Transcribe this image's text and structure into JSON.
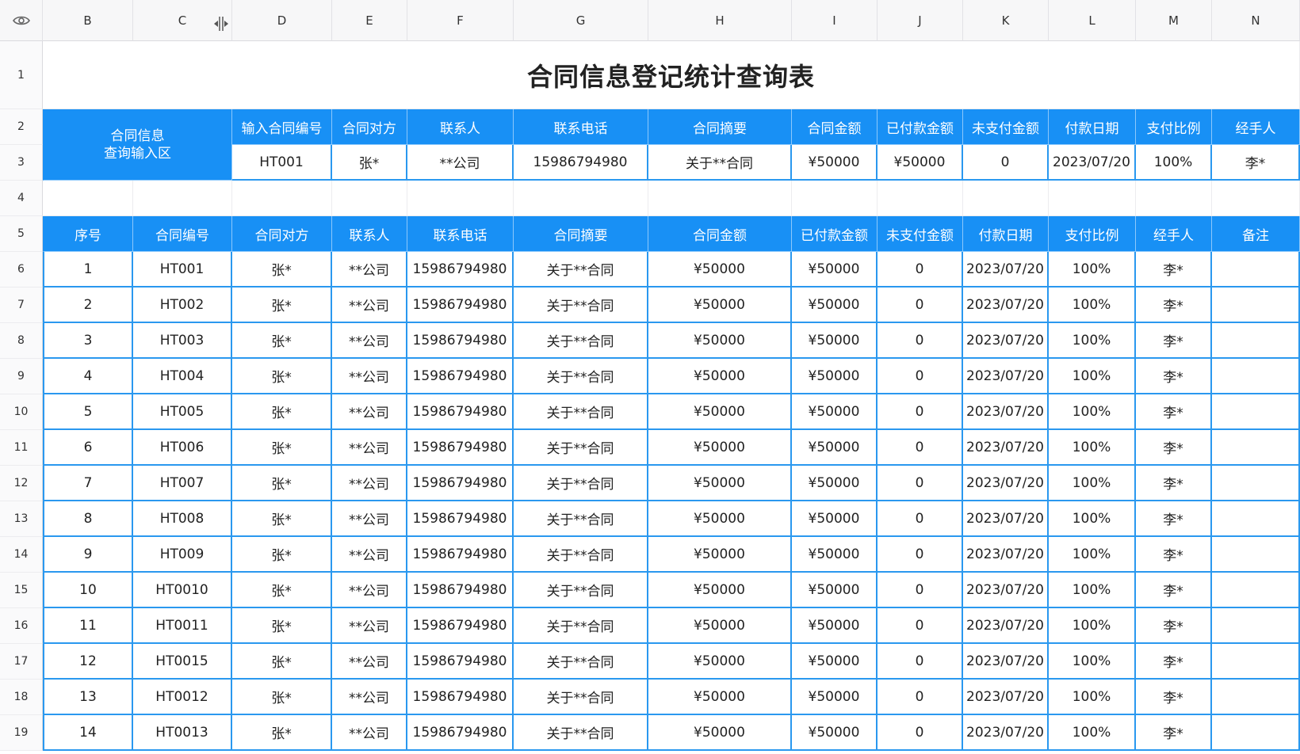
{
  "toolbar": {
    "visibility_icon": "eye-icon"
  },
  "columns": [
    "B",
    "C",
    "D",
    "E",
    "F",
    "G",
    "H",
    "I",
    "J",
    "K",
    "L",
    "M",
    "N"
  ],
  "rows": [
    "1",
    "2",
    "3",
    "4",
    "5",
    "6",
    "7",
    "8",
    "9",
    "10",
    "11",
    "12",
    "13",
    "14",
    "15",
    "16",
    "17",
    "18",
    "19"
  ],
  "title": "合同信息登记统计查询表",
  "query": {
    "label_line1": "合同信息",
    "label_line2": "查询输入区",
    "headers": [
      "输入合同编号",
      "合同对方",
      "联系人",
      "联系电话",
      "合同摘要",
      "合同金额",
      "已付款金额",
      "未支付金额",
      "付款日期",
      "支付比例",
      "经手人"
    ],
    "values": [
      "HT001",
      "张*",
      "**公司",
      "15986794980",
      "关于**合同",
      "¥50000",
      "¥50000",
      "0",
      "2023/07/20",
      "100%",
      "李*"
    ]
  },
  "table": {
    "headers": [
      "序号",
      "合同编号",
      "合同对方",
      "联系人",
      "联系电话",
      "合同摘要",
      "合同金额",
      "已付款金额",
      "未支付金额",
      "付款日期",
      "支付比例",
      "经手人",
      "备注"
    ],
    "rows": [
      [
        "1",
        "HT001",
        "张*",
        "**公司",
        "15986794980",
        "关于**合同",
        "¥50000",
        "¥50000",
        "0",
        "2023/07/20",
        "100%",
        "李*",
        ""
      ],
      [
        "2",
        "HT002",
        "张*",
        "**公司",
        "15986794980",
        "关于**合同",
        "¥50000",
        "¥50000",
        "0",
        "2023/07/20",
        "100%",
        "李*",
        ""
      ],
      [
        "3",
        "HT003",
        "张*",
        "**公司",
        "15986794980",
        "关于**合同",
        "¥50000",
        "¥50000",
        "0",
        "2023/07/20",
        "100%",
        "李*",
        ""
      ],
      [
        "4",
        "HT004",
        "张*",
        "**公司",
        "15986794980",
        "关于**合同",
        "¥50000",
        "¥50000",
        "0",
        "2023/07/20",
        "100%",
        "李*",
        ""
      ],
      [
        "5",
        "HT005",
        "张*",
        "**公司",
        "15986794980",
        "关于**合同",
        "¥50000",
        "¥50000",
        "0",
        "2023/07/20",
        "100%",
        "李*",
        ""
      ],
      [
        "6",
        "HT006",
        "张*",
        "**公司",
        "15986794980",
        "关于**合同",
        "¥50000",
        "¥50000",
        "0",
        "2023/07/20",
        "100%",
        "李*",
        ""
      ],
      [
        "7",
        "HT007",
        "张*",
        "**公司",
        "15986794980",
        "关于**合同",
        "¥50000",
        "¥50000",
        "0",
        "2023/07/20",
        "100%",
        "李*",
        ""
      ],
      [
        "8",
        "HT008",
        "张*",
        "**公司",
        "15986794980",
        "关于**合同",
        "¥50000",
        "¥50000",
        "0",
        "2023/07/20",
        "100%",
        "李*",
        ""
      ],
      [
        "9",
        "HT009",
        "张*",
        "**公司",
        "15986794980",
        "关于**合同",
        "¥50000",
        "¥50000",
        "0",
        "2023/07/20",
        "100%",
        "李*",
        ""
      ],
      [
        "10",
        "HT0010",
        "张*",
        "**公司",
        "15986794980",
        "关于**合同",
        "¥50000",
        "¥50000",
        "0",
        "2023/07/20",
        "100%",
        "李*",
        ""
      ],
      [
        "11",
        "HT0011",
        "张*",
        "**公司",
        "15986794980",
        "关于**合同",
        "¥50000",
        "¥50000",
        "0",
        "2023/07/20",
        "100%",
        "李*",
        ""
      ],
      [
        "12",
        "HT0015",
        "张*",
        "**公司",
        "15986794980",
        "关于**合同",
        "¥50000",
        "¥50000",
        "0",
        "2023/07/20",
        "100%",
        "李*",
        ""
      ],
      [
        "13",
        "HT0012",
        "张*",
        "**公司",
        "15986794980",
        "关于**合同",
        "¥50000",
        "¥50000",
        "0",
        "2023/07/20",
        "100%",
        "李*",
        ""
      ],
      [
        "14",
        "HT0013",
        "张*",
        "**公司",
        "15986794980",
        "关于**合同",
        "¥50000",
        "¥50000",
        "0",
        "2023/07/20",
        "100%",
        "李*",
        ""
      ]
    ]
  },
  "colors": {
    "header_blue": "#1890f5",
    "grid_blue": "#2a98ef"
  }
}
